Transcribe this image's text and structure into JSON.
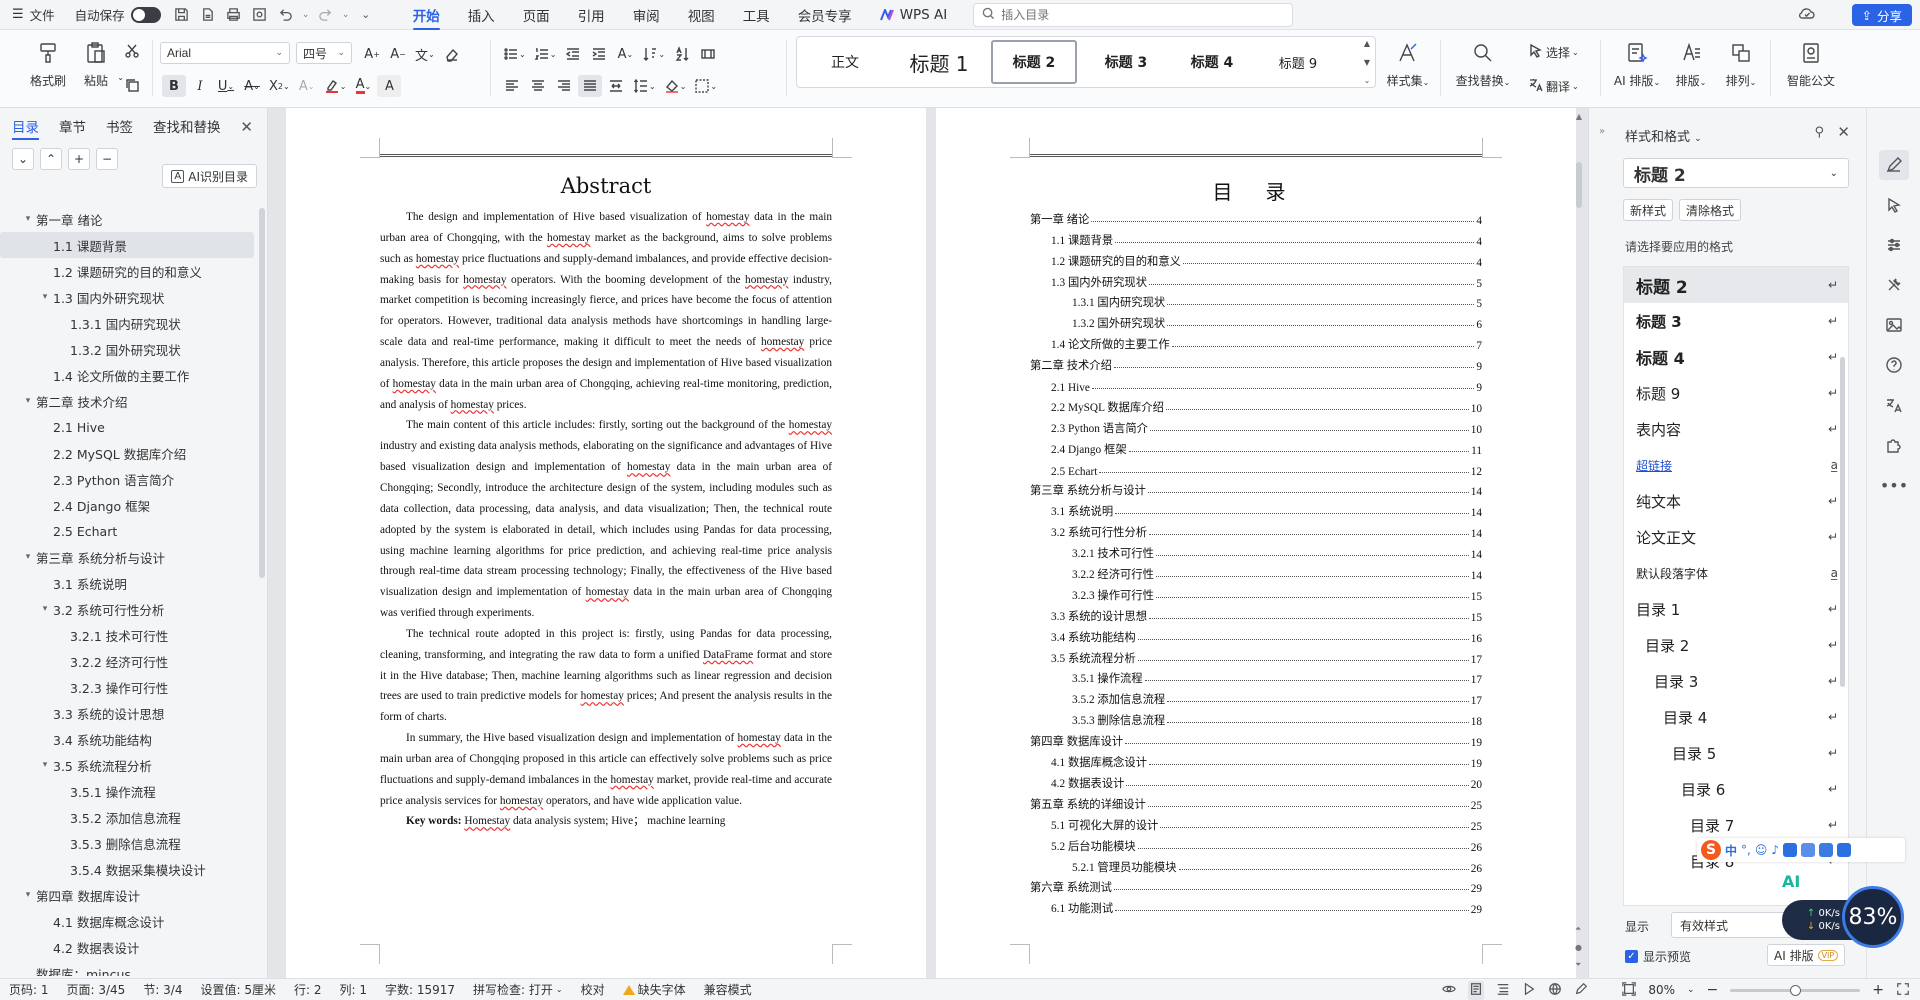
{
  "titlebar": {
    "file_menu": "文件",
    "autosave_label": "自动保存",
    "menu_tabs": [
      "开始",
      "插入",
      "页面",
      "引用",
      "审阅",
      "视图",
      "工具",
      "会员专享"
    ],
    "active_tab": "开始",
    "wps_ai": "WPS AI",
    "search_placeholder": "插入目录",
    "share": "分享"
  },
  "ribbon": {
    "format_painter": "格式刷",
    "paste": "粘贴",
    "font_name": "Arial",
    "font_size": "四号",
    "styles": [
      "正文",
      "标题 1",
      "标题 2",
      "标题 3",
      "标题 4",
      "标题 9"
    ],
    "selected_style": "标题 2",
    "style_set": "样式集",
    "find_replace": "查找替换",
    "select": "选择",
    "translate": "翻译",
    "ai_layout": "AI 排版",
    "layout": "排版",
    "arrange": "排列",
    "smart_doc": "智能公文"
  },
  "nav": {
    "tabs": [
      "目录",
      "章节",
      "书签",
      "查找和替换"
    ],
    "active_tab": "目录",
    "ai_toc": "AI识别目录",
    "items": [
      {
        "label": "第一章  绪论",
        "level": 0,
        "expand": "open"
      },
      {
        "label": "1.1 课题背景",
        "level": 1,
        "active": true
      },
      {
        "label": "1.2 课题研究的目的和意义",
        "level": 1
      },
      {
        "label": "1.3  国内外研究现状",
        "level": 1,
        "expand": "open"
      },
      {
        "label": "1.3.1  国内研究现状",
        "level": 2
      },
      {
        "label": "1.3.2  国外研究现状",
        "level": 2
      },
      {
        "label": "1.4 论文所做的主要工作",
        "level": 1
      },
      {
        "label": "第二章  技术介绍",
        "level": 0,
        "expand": "open"
      },
      {
        "label": "2.1 Hive",
        "level": 1
      },
      {
        "label": "2.2 MySQL 数据库介绍",
        "level": 1
      },
      {
        "label": "2.3 Python 语言简介",
        "level": 1
      },
      {
        "label": "2.4 Django 框架",
        "level": 1
      },
      {
        "label": "2.5 Echart",
        "level": 1
      },
      {
        "label": "第三章  系统分析与设计",
        "level": 0,
        "expand": "open"
      },
      {
        "label": "3.1 系统说明",
        "level": 1
      },
      {
        "label": "3.2 系统可行性分析",
        "level": 1,
        "expand": "open"
      },
      {
        "label": "3.2.1  技术可行性",
        "level": 2
      },
      {
        "label": "3.2.2  经济可行性",
        "level": 2
      },
      {
        "label": "3.2.3  操作可行性",
        "level": 2
      },
      {
        "label": "3.3 系统的设计思想",
        "level": 1
      },
      {
        "label": "3.4 系统功能结构",
        "level": 1
      },
      {
        "label": "3.5 系统流程分析",
        "level": 1,
        "expand": "open"
      },
      {
        "label": "3.5.1 操作流程",
        "level": 2
      },
      {
        "label": "3.5.2 添加信息流程",
        "level": 2
      },
      {
        "label": "3.5.3 删除信息流程",
        "level": 2
      },
      {
        "label": "3.5.4 数据采集模块设计",
        "level": 2
      },
      {
        "label": "第四章  数据库设计",
        "level": 0,
        "expand": "open"
      },
      {
        "label": "4.1 数据库概念设计",
        "level": 1
      },
      {
        "label": "4.2 数据表设计",
        "level": 1
      },
      {
        "label": "数据库：mincus",
        "level": 0
      }
    ]
  },
  "abstract": {
    "title": "Abstract",
    "paragraphs": [
      [
        {
          "t": "The design and implementation of Hive based visualization of "
        },
        {
          "t": "homestay",
          "w": true
        },
        {
          "t": " data in the main urban area of Chongqing, with the "
        },
        {
          "t": "homestay",
          "w": true
        },
        {
          "t": " market as the background, aims to solve problems such as "
        },
        {
          "t": "homestay",
          "w": true
        },
        {
          "t": " price fluctuations and supply-demand imbalances, and provide effective decision-making basis for "
        },
        {
          "t": "homestay",
          "w": true
        },
        {
          "t": " operators. With the booming development of the "
        },
        {
          "t": "homestay",
          "w": true
        },
        {
          "t": " industry, market competition is becoming increasingly fierce, and prices have become the focus of attention for operators. However, traditional data analysis methods have shortcomings in handling large-scale data and real-time performance, making it difficult to meet the needs of "
        },
        {
          "t": "homestay",
          "w": true
        },
        {
          "t": " price analysis. Therefore, this article proposes the design and implementation of Hive based visualization of "
        },
        {
          "t": "homestay",
          "w": true
        },
        {
          "t": " data in the main urban area of Chongqing, achieving real-time monitoring, prediction, and analysis of "
        },
        {
          "t": "homestay",
          "w": true
        },
        {
          "t": " prices."
        }
      ],
      [
        {
          "t": "The main content of this article includes: firstly, sorting out the background of the "
        },
        {
          "t": "homestay",
          "w": true
        },
        {
          "t": " industry and existing data analysis methods, elaborating on the significance and advantages of Hive based visualization design and implementation of "
        },
        {
          "t": "homestay",
          "w": true
        },
        {
          "t": " data in the main urban area of Chongqing; Secondly, introduce the architecture design of the system, including modules such as data collection, data processing, data analysis, and data visualization; Then, the technical route adopted by the system is elaborated in detail, which includes using Pandas for data processing, using machine learning algorithms for price prediction, and achieving real-time price analysis through real-time data stream processing technology; Finally, the effectiveness of the Hive based visualization design and implementation of "
        },
        {
          "t": "homestay",
          "w": true
        },
        {
          "t": " data in the main urban area of Chongqing was verified through experiments."
        }
      ],
      [
        {
          "t": "The technical route adopted in this project is: firstly, using Pandas for data processing, cleaning, transforming, and integrating the raw data to form a unified "
        },
        {
          "t": "DataFrame",
          "w": true
        },
        {
          "t": " format and store it in the Hive database; Then, machine learning algorithms such as linear regression and decision trees are used to train predictive models for "
        },
        {
          "t": "homestay",
          "w": true
        },
        {
          "t": " prices; And present the analysis results in the form of charts."
        }
      ],
      [
        {
          "t": "In summary, the Hive based visualization design and implementation of "
        },
        {
          "t": "homestay",
          "w": true
        },
        {
          "t": " data in the main urban area of Chongqing proposed in this article can effectively solve problems such as price fluctuations and supply-demand imbalances in the "
        },
        {
          "t": "homestay",
          "w": true
        },
        {
          "t": " market, provide real-time and accurate price analysis services for "
        },
        {
          "t": "homestay",
          "w": true
        },
        {
          "t": " operators, and have wide application value."
        }
      ]
    ],
    "keywords_label": "Key words: ",
    "keywords": [
      {
        "t": "Homestay",
        "w": true
      },
      {
        "t": " data analysis system; Hive； machine learning"
      }
    ]
  },
  "toc": {
    "title": "目 录",
    "entries": [
      {
        "text": "第一章  绪论",
        "page": "4",
        "level": 0
      },
      {
        "text": "1.1 课题背景",
        "page": "4",
        "level": 1
      },
      {
        "text": "1.2 课题研究的目的和意义",
        "page": "4",
        "level": 1
      },
      {
        "text": "1.3  国内外研究现状",
        "page": "5",
        "level": 1
      },
      {
        "text": "1.3.1  国内研究现状",
        "page": "5",
        "level": 2
      },
      {
        "text": "1.3.2  国外研究现状",
        "page": "6",
        "level": 2
      },
      {
        "text": "1.4 论文所做的主要工作",
        "page": "7",
        "level": 1
      },
      {
        "text": "第二章  技术介绍",
        "page": "9",
        "level": 0
      },
      {
        "text": "2.1 Hive",
        "page": "9",
        "level": 1
      },
      {
        "text": "2.2 MySQL 数据库介绍",
        "page": "10",
        "level": 1
      },
      {
        "text": "2.3 Python 语言简介",
        "page": "10",
        "level": 1
      },
      {
        "text": "2.4 Django 框架",
        "page": "11",
        "level": 1
      },
      {
        "text": "2.5 Echart",
        "page": "12",
        "level": 1
      },
      {
        "text": "第三章  系统分析与设计",
        "page": "14",
        "level": 0
      },
      {
        "text": "3.1 系统说明",
        "page": "14",
        "level": 1
      },
      {
        "text": "3.2 系统可行性分析",
        "page": "14",
        "level": 1
      },
      {
        "text": "3.2.1  技术可行性",
        "page": "14",
        "level": 2
      },
      {
        "text": "3.2.2  经济可行性",
        "page": "14",
        "level": 2
      },
      {
        "text": "3.2.3  操作可行性",
        "page": "15",
        "level": 2
      },
      {
        "text": "3.3 系统的设计思想",
        "page": "15",
        "level": 1
      },
      {
        "text": "3.4 系统功能结构",
        "page": "16",
        "level": 1
      },
      {
        "text": "3.5 系统流程分析",
        "page": "17",
        "level": 1
      },
      {
        "text": "3.5.1 操作流程",
        "page": "17",
        "level": 2
      },
      {
        "text": "3.5.2 添加信息流程",
        "page": "17",
        "level": 2
      },
      {
        "text": "3.5.3 删除信息流程",
        "page": "18",
        "level": 2
      },
      {
        "text": "第四章  数据库设计",
        "page": "19",
        "level": 0
      },
      {
        "text": "4.1 数据库概念设计",
        "page": "19",
        "level": 1
      },
      {
        "text": "4.2 数据表设计",
        "page": "20",
        "level": 1
      },
      {
        "text": "第五章  系统的详细设计",
        "page": "25",
        "level": 0
      },
      {
        "text": "5.1 可视化大屏的设计",
        "page": "25",
        "level": 1
      },
      {
        "text": "5.2 后台功能模块",
        "page": "26",
        "level": 1
      },
      {
        "text": "5.2.1 管理员功能模块",
        "page": "26",
        "level": 2
      },
      {
        "text": "第六章  系统测试",
        "page": "29",
        "level": 0
      },
      {
        "text": "6.1  功能测试",
        "page": "29",
        "level": 1
      }
    ]
  },
  "styles_pane": {
    "title": "样式和格式",
    "current_style": "标题 2",
    "new_style": "新样式",
    "clear_format": "清除格式",
    "prompt": "请选择要应用的格式",
    "items": [
      {
        "name": "标题 2",
        "size": 17,
        "bold": true,
        "indent": 0,
        "highlight": true
      },
      {
        "name": "标题 3",
        "size": 15,
        "bold": true,
        "indent": 0
      },
      {
        "name": "标题 4",
        "size": 16,
        "bold": true,
        "indent": 0
      },
      {
        "name": "标题 9",
        "size": 15,
        "bold": false,
        "indent": 0
      },
      {
        "name": "表内容",
        "size": 15,
        "bold": false,
        "indent": 0
      },
      {
        "name": "超链接",
        "size": 12,
        "bold": false,
        "indent": 0,
        "link": true,
        "mark": "a"
      },
      {
        "name": "纯文本",
        "size": 15,
        "bold": false,
        "indent": 0
      },
      {
        "name": "论文正文",
        "size": 15,
        "bold": false,
        "indent": 0
      },
      {
        "name": "默认段落字体",
        "size": 12,
        "bold": false,
        "indent": 0,
        "mark": "a"
      },
      {
        "name": "目录 1",
        "size": 15,
        "bold": false,
        "indent": 0
      },
      {
        "name": "目录 2",
        "size": 15,
        "bold": false,
        "indent": 9
      },
      {
        "name": "目录 3",
        "size": 15,
        "bold": false,
        "indent": 18
      },
      {
        "name": "目录 4",
        "size": 15,
        "bold": false,
        "indent": 27
      },
      {
        "name": "目录 5",
        "size": 15,
        "bold": false,
        "indent": 36
      },
      {
        "name": "目录 6",
        "size": 15,
        "bold": false,
        "indent": 45
      },
      {
        "name": "目录 7",
        "size": 15,
        "bold": false,
        "indent": 54
      },
      {
        "name": "目录 8",
        "size": 15,
        "bold": false,
        "indent": 54
      }
    ],
    "show_label": "显示",
    "show_value": "有效样式",
    "preview": "显示预览",
    "ai_layout": "AI 排版",
    "vip": "VIP"
  },
  "ime": {
    "lang": "中"
  },
  "net": {
    "up": "0K/s",
    "down": "0K/s",
    "percent": "83%"
  },
  "ai_badge": "AI",
  "status": {
    "page_no": "页码: 1",
    "pages": "页面: 3/45",
    "section": "节: 3/4",
    "setting": "设置值: 5厘米",
    "row": "行: 2",
    "col": "列: 1",
    "words": "字数: 15917",
    "spell": "拼写检查: 打开",
    "proof": "校对",
    "missing_font": "缺失字体",
    "compat": "兼容模式",
    "zoom": "80%",
    "zoom_level": 0.5
  }
}
